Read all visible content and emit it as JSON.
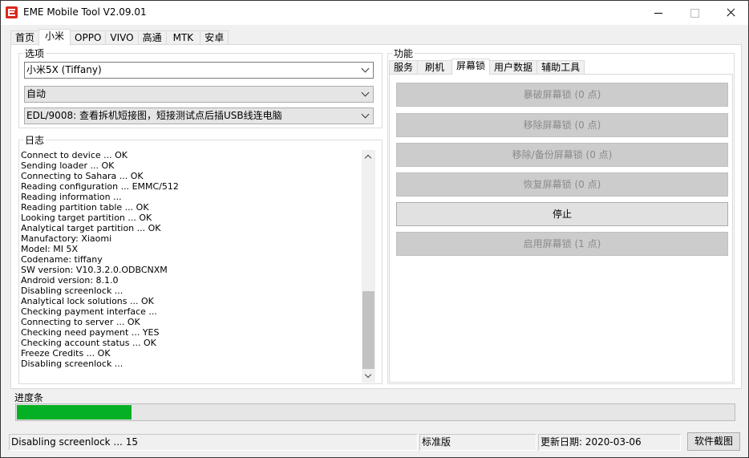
{
  "window": {
    "title": "EME Mobile Tool V2.09.01"
  },
  "main_tabs": [
    {
      "label": "首页"
    },
    {
      "label": "小米"
    },
    {
      "label": "OPPO"
    },
    {
      "label": "VIVO"
    },
    {
      "label": "高通"
    },
    {
      "label": "MTK"
    },
    {
      "label": "安卓"
    }
  ],
  "options": {
    "legend": "选项",
    "model_select": "小米5X (Tiffany)",
    "mode_select": "自动",
    "edl_select": "EDL/9008: 查看拆机短接图，短接测试点后插USB线连电脑"
  },
  "log": {
    "legend": "日志",
    "lines": [
      "Connect to device ... OK",
      "Sending loader ... OK",
      "Connecting to Sahara ... OK",
      "Reading configuration ... EMMC/512",
      "Reading information ...",
      "Reading partition table ... OK",
      "Looking target partition ... OK",
      "Analytical target partition ... OK",
      "Manufactory: Xiaomi",
      "Model: MI 5X",
      "Codename: tiffany",
      "SW version: V10.3.2.0.ODBCNXM",
      "Android version: 8.1.0",
      "Disabling screenlock ...",
      "Analytical lock solutions ... OK",
      "Checking payment interface ...",
      "Connecting to server ... OK",
      "Checking need payment ... YES",
      "Checking account status ... OK",
      "Freeze Credits ... OK",
      "Disabling screenlock ..."
    ]
  },
  "function": {
    "legend": "功能",
    "tabs": [
      {
        "label": "服务"
      },
      {
        "label": "刷机"
      },
      {
        "label": "屏幕锁"
      },
      {
        "label": "用户数据"
      },
      {
        "label": "辅助工具"
      }
    ],
    "buttons": [
      {
        "label": "暴破屏幕锁 (0 点)"
      },
      {
        "label": "移除屏幕锁 (0 点)"
      },
      {
        "label": "移除/备份屏幕锁 (0 点)"
      },
      {
        "label": "恢复屏幕锁 (0 点)"
      },
      {
        "label": "停止"
      },
      {
        "label": "启用屏幕锁 (1 点)"
      }
    ]
  },
  "progress": {
    "label": "进度条",
    "value": 0.16,
    "color": "#06b025"
  },
  "status": {
    "message": "Disabling screenlock ... 15",
    "edition": "标准版",
    "update_date": "更新日期: 2020-03-06",
    "screenshot_button": "软件截图"
  }
}
